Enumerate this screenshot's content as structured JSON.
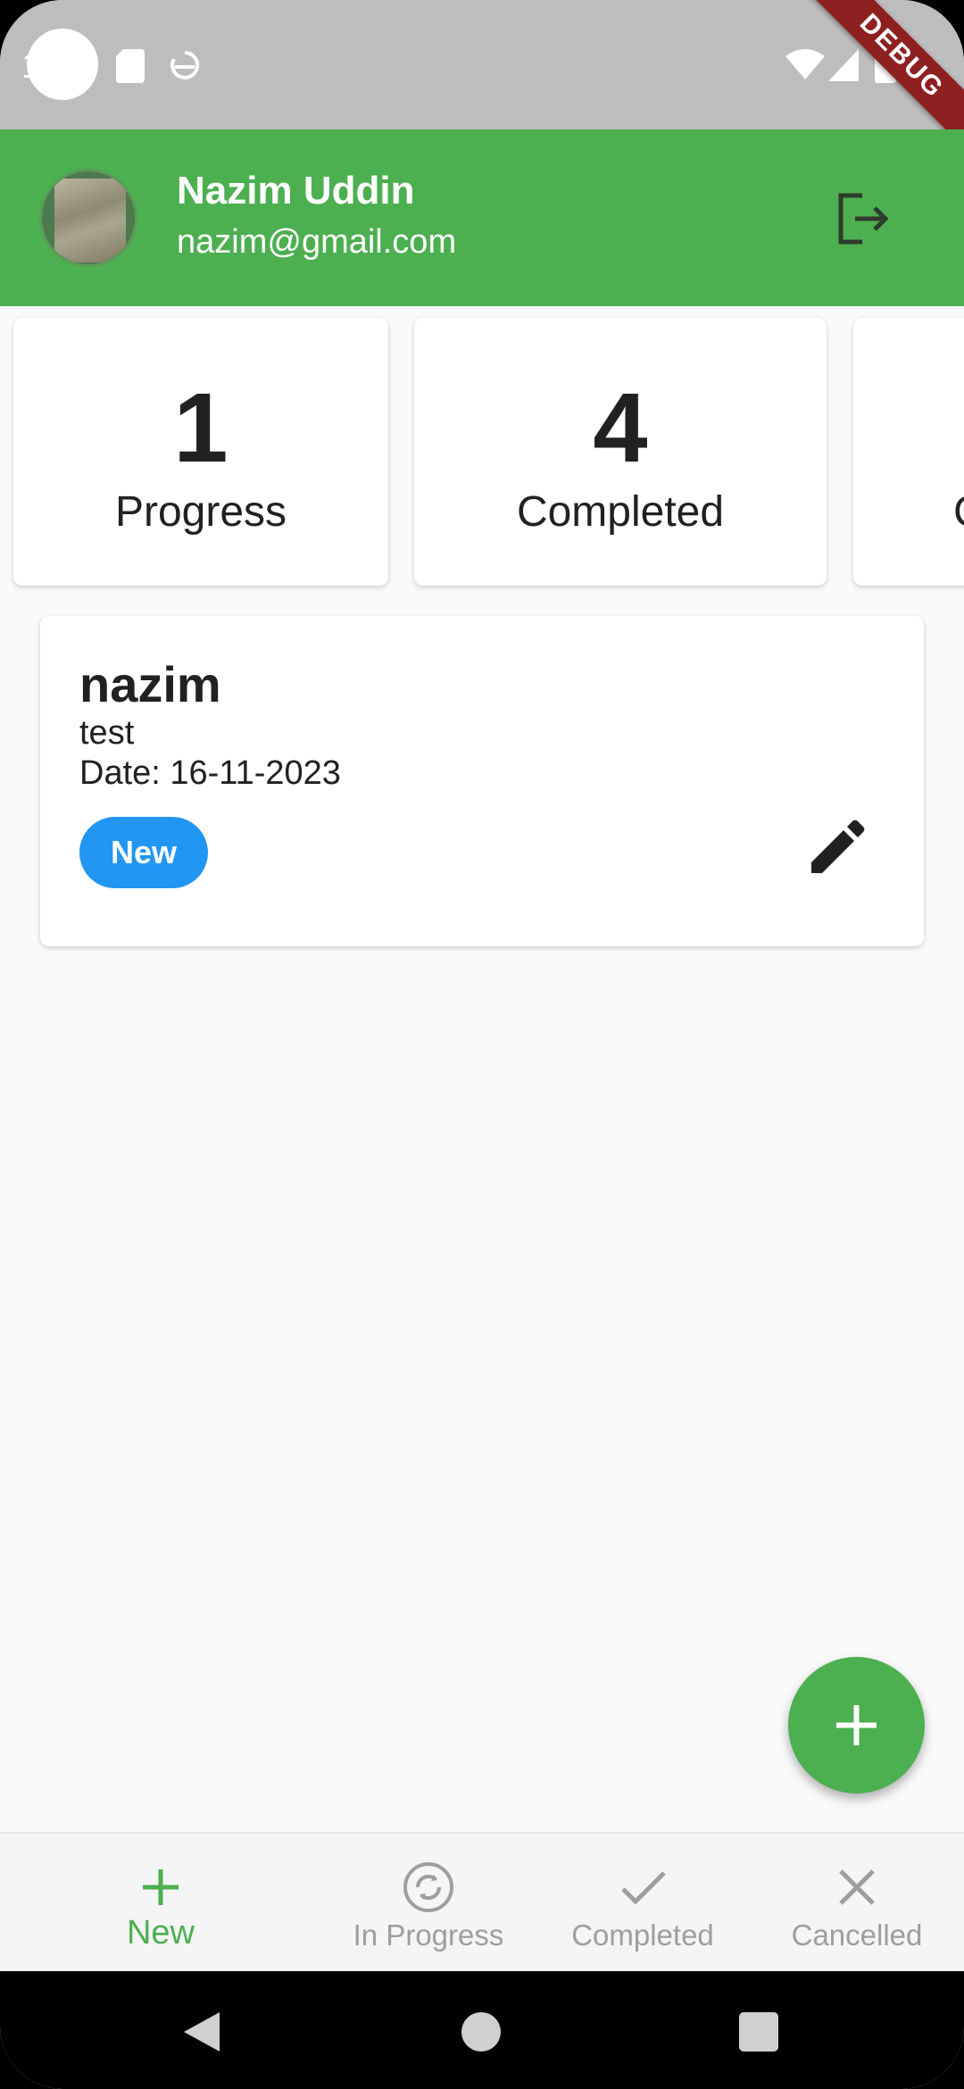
{
  "status_bar": {
    "clock": "1",
    "debug_banner": "DEBUG"
  },
  "header": {
    "user_name": "Nazim Uddin",
    "user_email": "nazim@gmail.com",
    "accent": "#4caf50"
  },
  "summary": [
    {
      "count": "1",
      "label": "Progress"
    },
    {
      "count": "4",
      "label": "Completed"
    },
    {
      "count": "",
      "label": "C"
    }
  ],
  "tasks": [
    {
      "title": "nazim",
      "description": "test",
      "date": "Date: 16-11-2023",
      "status": "New",
      "status_color": "#2196f3"
    }
  ],
  "bottom_nav": [
    {
      "label": "New",
      "icon": "plus-icon",
      "active": true
    },
    {
      "label": "In Progress",
      "icon": "sync-icon",
      "active": false
    },
    {
      "label": "Completed",
      "icon": "check-icon",
      "active": false
    },
    {
      "label": "Cancelled",
      "icon": "close-icon",
      "active": false
    }
  ]
}
